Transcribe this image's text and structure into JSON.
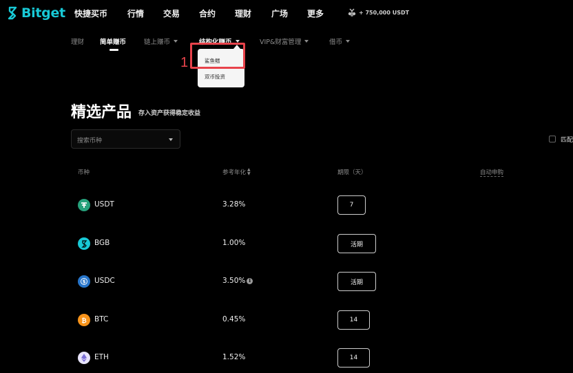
{
  "brand": {
    "name": "Bitget",
    "color": "#18c9d6"
  },
  "topnav": {
    "items": [
      "快捷买币",
      "行情",
      "交易",
      "合约",
      "理财",
      "广场",
      "更多"
    ],
    "reward": "+ 750,000 USDT"
  },
  "subnav": {
    "items": [
      {
        "label": "理财",
        "has_caret": false
      },
      {
        "label": "简单赚币",
        "has_caret": false,
        "active": true
      },
      {
        "label": "链上赚币",
        "has_caret": true
      },
      {
        "label": "结构化赚币",
        "has_caret": true,
        "open": true
      },
      {
        "label": "VIP&财富管理",
        "has_caret": true
      },
      {
        "label": "借币",
        "has_caret": true
      }
    ]
  },
  "dropdown": {
    "items": [
      "鲨鱼鳍",
      "双币投资"
    ],
    "annotation_number": "1",
    "highlight_color": "#e8434b"
  },
  "main": {
    "title": "精选产品",
    "subtitle": "存入资产获得稳定收益",
    "coin_select_placeholder": "搜索币种",
    "match_label": "匹配"
  },
  "table": {
    "headers": [
      "币种",
      "参考年化",
      "期限（天）",
      "自动申购"
    ],
    "rows": [
      {
        "coin": "USDT",
        "apy": "3.28%",
        "term": "7",
        "icon": "tether-icon",
        "color": "#26a17b"
      },
      {
        "coin": "BGB",
        "apy": "1.00%",
        "term": "活期",
        "icon": "bitget-icon",
        "color": "#18c9d6"
      },
      {
        "coin": "USDC",
        "apy": "3.50%",
        "term": "活期",
        "icon": "usdc-icon",
        "color": "#2775ca",
        "info": true
      },
      {
        "coin": "BTC",
        "apy": "0.45%",
        "term": "14",
        "icon": "bitcoin-icon",
        "color": "#f7931a"
      },
      {
        "coin": "ETH",
        "apy": "1.52%",
        "term": "14",
        "icon": "ethereum-icon",
        "color": "#c9c4ef"
      }
    ]
  }
}
